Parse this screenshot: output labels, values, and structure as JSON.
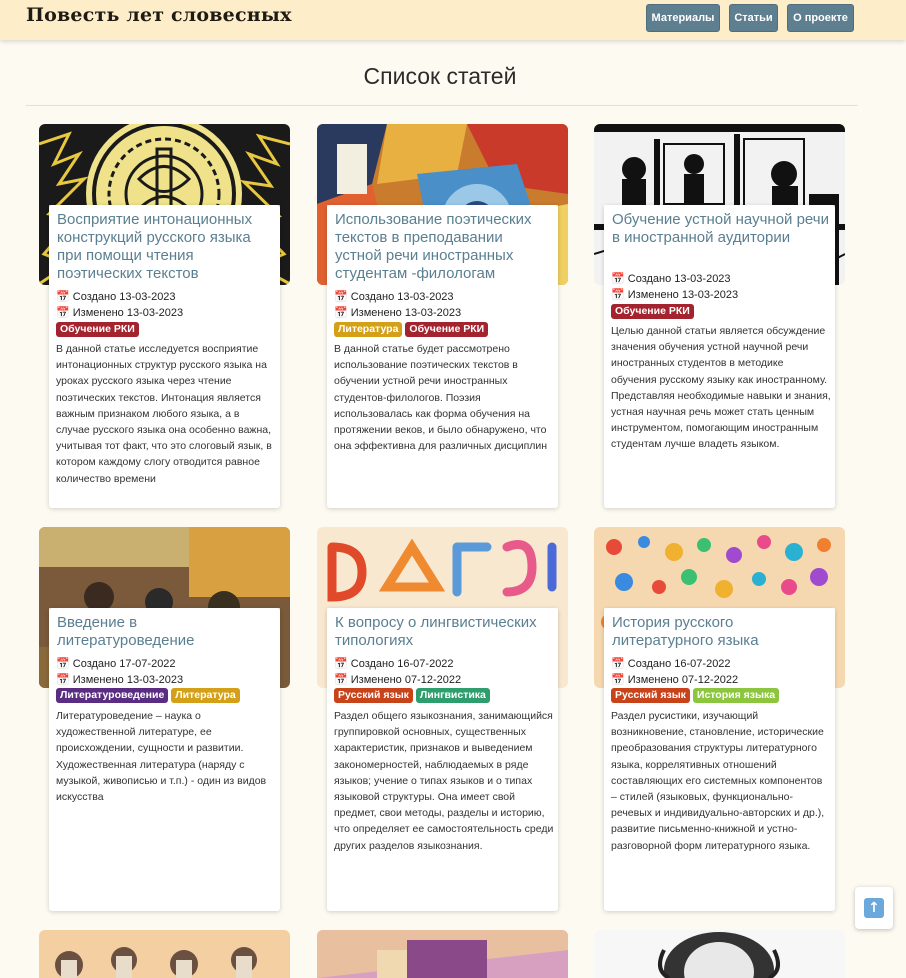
{
  "site": {
    "brand": "Повесть лет словесных"
  },
  "nav": {
    "materials": "Материалы",
    "articles": "Статьи",
    "about": "О проекте"
  },
  "page": {
    "title": "Список статей"
  },
  "colors": {
    "navbar": "#fdeec9",
    "nav_button": "#5e7f8f",
    "title_link": "#5a7f90",
    "background": "#fdfaf1"
  },
  "icons": {
    "date": "calendar-icon",
    "scroll_top": "arrow-up-icon"
  },
  "articles": [
    {
      "title": "Восприятие интонационных конструкций русского языка при помощи чтения поэтических текстов",
      "created": "📅 Создано 13-03-2023",
      "updated": "📅 Изменено 13-03-2023",
      "tags": [
        {
          "label": "Обучение РКИ",
          "color": "#a3242f"
        }
      ],
      "description": "В данной статье исследуется восприятие интонационных структур русского языка на уроках русского языка через чтение поэтических текстов. Интонация является важным признаком любого языка, а в случае русского языка она особенно важна, учитывая тот факт, что это слоговый язык, в котором каждому слогу отводится равное количество времени"
    },
    {
      "title": "Использование поэтических текстов в преподавании устной речи иностранных студентам -филологам",
      "created": "📅 Создано 13-03-2023",
      "updated": "📅 Изменено 13-03-2023",
      "tags": [
        {
          "label": "Литература",
          "color": "#d4a017"
        },
        {
          "label": "Обучение РКИ",
          "color": "#a3242f"
        }
      ],
      "description": "В данной статье будет рассмотрено использование поэтических текстов в обучении устной речи иностранных студентов-филологов. Поэзия использовалась как форма обучения на протяжении веков, и было обнаружено, что она эффективна для различных дисциплин"
    },
    {
      "title": "Обучение устной научной речи в иностранной аудитории",
      "created": "📅 Создано 13-03-2023",
      "updated": "📅 Изменено 13-03-2023",
      "tags": [
        {
          "label": "Обучение РКИ",
          "color": "#a3242f"
        }
      ],
      "description": "Целью данной статьи является обсуждение значения обучения устной научной речи иностранных студентов в методике обучения русскому языку как иностранному. Представляя необходимые навыки и знания, устная научная речь может стать ценным инструментом, помогающим иностранным студентам лучше владеть языком."
    },
    {
      "title": "Введение в литературоведение",
      "created": "📅 Создано 17-07-2022",
      "updated": "📅 Изменено 13-03-2023",
      "tags": [
        {
          "label": "Литературоведение",
          "color": "#5a2d82"
        },
        {
          "label": "Литература",
          "color": "#d4a017"
        }
      ],
      "description": "Литературоведение – наука о художественной литературе, ее происхождении, сущности и развитии. Художественная литература (наряду с музыкой, живописью и т.п.) - один из видов искусства"
    },
    {
      "title": "К вопросу о лингвистических типологиях",
      "created": "📅 Создано 16-07-2022",
      "updated": "📅 Изменено 07-12-2022",
      "tags": [
        {
          "label": "Русский язык",
          "color": "#c8421a"
        },
        {
          "label": "Лингвистика",
          "color": "#2e9e6e"
        }
      ],
      "description": "Раздел общего языкознания, занимающийся группировкой основных, существенных характеристик, признаков и выведением закономерностей, наблюдаемых в ряде языков; учение о типах языков и о типах языковой структуры. Она имеет свой предмет, свои методы, разделы и историю, что определяет ее самостоятельность среди других разделов языкознания."
    },
    {
      "title": "История русского литературного языка",
      "created": "📅 Создано 16-07-2022",
      "updated": "📅 Изменено 07-12-2022",
      "tags": [
        {
          "label": "Русский язык",
          "color": "#c8421a"
        },
        {
          "label": "История языка",
          "color": "#8cc63f"
        }
      ],
      "description": "Раздел русистики, изучающий возникновение, становление, исторические преобразования структуры литературного языка, коррелятивных отношений составляющих его системных компонентов – стилей (языковых, функционально-речевых и индивидуально-авторских и др.), развитие письменно-книжной и устно-разговорной форм литературного языка."
    }
  ]
}
